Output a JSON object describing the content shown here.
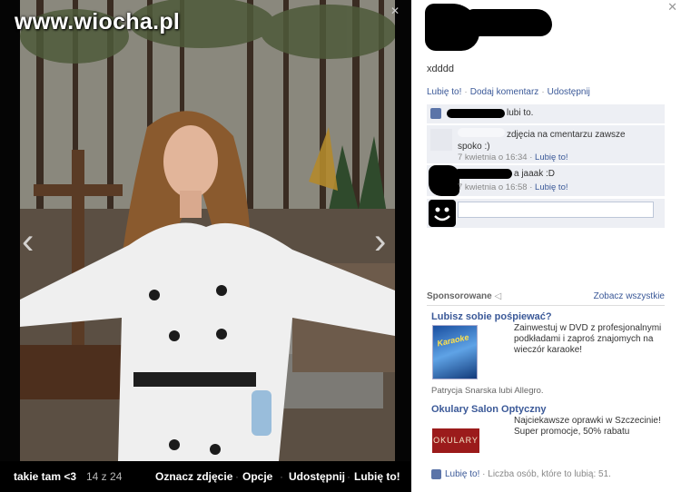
{
  "watermark": {
    "site": "www.wiocha.pl"
  },
  "photo": {
    "album_title": "takie tam <3",
    "count": "14 z 24",
    "actions": [
      "Oznacz zdjęcie",
      "Opcje",
      "Udostępnij",
      "Lubię to!"
    ]
  },
  "post": {
    "text": "xdddd",
    "actions": [
      "Lubię to!",
      "Dodaj komentarz",
      "Udostępnij"
    ],
    "likes_text": "lubi to."
  },
  "comments": [
    {
      "text": "zdjęcia na cmentarzu zawsze spoko :)",
      "time": "7 kwietnia o 16:34",
      "like": "Lubię to!"
    },
    {
      "text": "a jaaak :D",
      "time": "7 kwietnia o 16:58",
      "like": "Lubię to!"
    }
  ],
  "sponsored": {
    "label": "Sponsorowane",
    "see_all": "Zobacz wszystkie",
    "ads": [
      {
        "title": "Lubisz sobie pośpiewać?",
        "desc": "Zainwestuj w DVD z profesjonalnymi podkładami i zaproś znajomych na wieczór karaoke!",
        "social": "Patrycja Snarska lubi Allegro.",
        "image_text": "Karaoke"
      },
      {
        "title": "Okulary Salon Optyczny",
        "desc": "Najciekawsze oprawki w Szczecinie! Super promocje, 50% rabatu",
        "image_text": "OKULARY"
      }
    ]
  },
  "footer": {
    "like": "Lubię to!",
    "likes_count": "Liczba osób, które to lubią: 51."
  },
  "colors": {
    "link": "#3b5998",
    "panel": "#edeff4",
    "ad_red": "#9b1b1b"
  },
  "icons": [
    "close-icon",
    "thumb-up-icon",
    "chevron-left-icon",
    "chevron-right-icon",
    "smiley-icon",
    "tag-icon"
  ]
}
